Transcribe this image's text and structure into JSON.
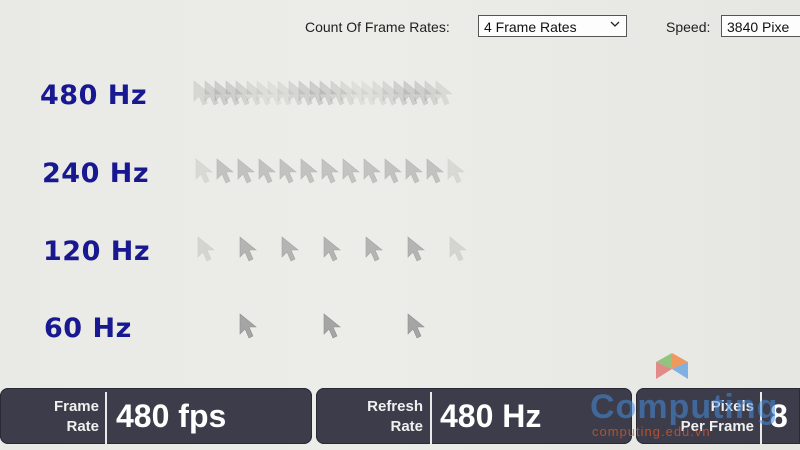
{
  "top_controls": {
    "count_label": "Count Of Frame Rates:",
    "count_value": "4 Frame Rates",
    "speed_label": "Speed:",
    "speed_value": "3840 Pixe"
  },
  "rows": [
    {
      "label": "480 Hz"
    },
    {
      "label": "240 Hz"
    },
    {
      "label": "120 Hz"
    },
    {
      "label": "60 Hz"
    }
  ],
  "bottom_bar": {
    "frame_rate_caption_1": "Frame",
    "frame_rate_caption_2": "Rate",
    "frame_rate_value": "480 fps",
    "refresh_rate_caption_1": "Refresh",
    "refresh_rate_caption_2": "Rate",
    "refresh_rate_value": "480 Hz",
    "pixels_caption_1": "Pixels",
    "pixels_caption_2": "Per Frame",
    "pixels_value": "8"
  },
  "watermark": {
    "brand": "Computing",
    "url": "computing.edu.vn"
  },
  "icons": {
    "dropdown": "chevron-down-icon",
    "cursor": "mouse-pointer-icon"
  },
  "colors": {
    "label_blue": "#181890",
    "panel_bg": "#3c3c4a",
    "cursor_gray": "#a4a4a4"
  }
}
